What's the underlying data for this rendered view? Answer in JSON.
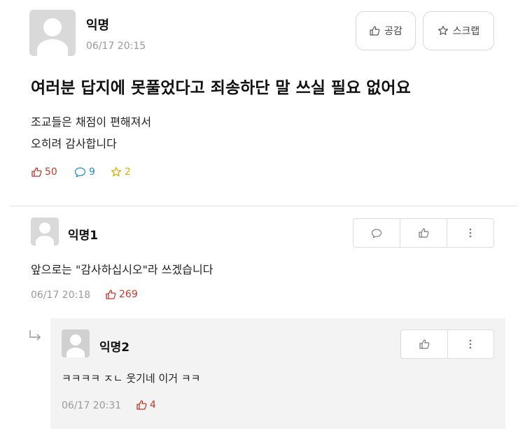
{
  "post": {
    "author": "익명",
    "datetime": "06/17 20:15",
    "title": "여러분 답지에 못풀었다고 죄송하단 말 쓰실 필요 없어요",
    "body_lines": [
      "조교들은 채점이 편해져서",
      "오히려 감사합니다"
    ],
    "like_button_label": "공감",
    "scrap_button_label": "스크랩",
    "stats": {
      "likes": "50",
      "comments": "9",
      "scraps": "2"
    },
    "colors": {
      "likes": "#c0392b",
      "comments": "#1e90c8",
      "scraps": "#d4b000"
    }
  },
  "comments": [
    {
      "author": "익명1",
      "text": "앞으로는 \"감사하십시오\"라 쓰겠습니다",
      "datetime": "06/17 20:18",
      "likes": "269"
    }
  ],
  "reply": {
    "author": "익명2",
    "text": "ㅋㅋㅋㅋ ㅈㄴ 웃기네 이거 ㅋㅋ",
    "datetime": "06/17 20:31",
    "likes": "4"
  }
}
